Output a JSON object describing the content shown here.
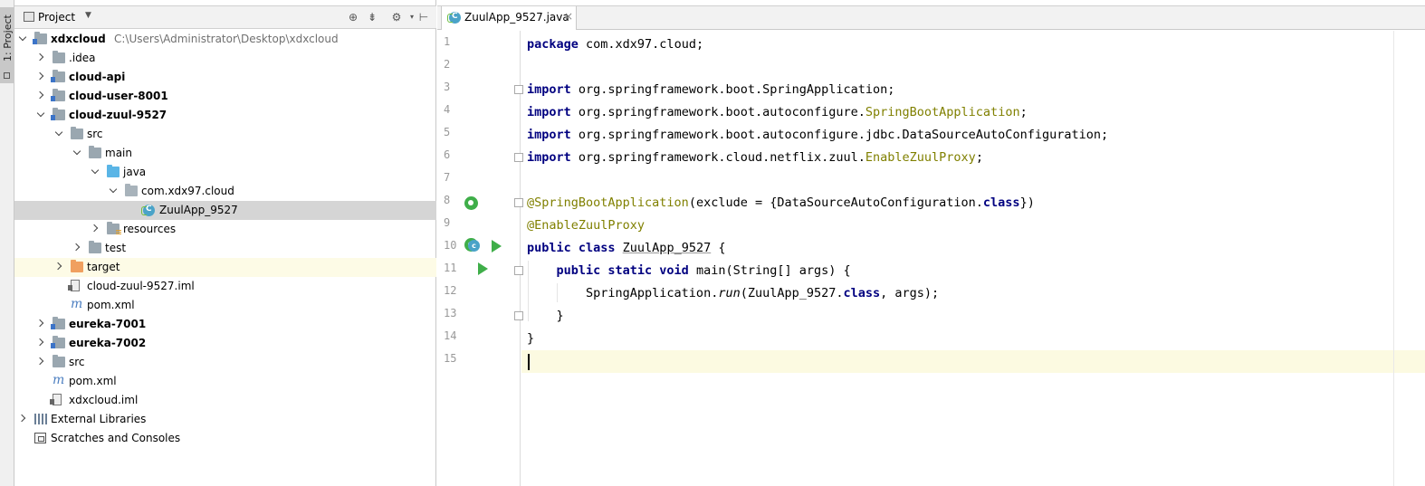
{
  "tool_stripe": {
    "project_tab_label": "1: Project"
  },
  "project_panel": {
    "title": "Project",
    "tree": [
      {
        "label": "xdxcloud",
        "path": "C:\\Users\\Administrator\\Desktop\\xdxcloud",
        "bold": true,
        "expanded": true,
        "icon": "module-folder-icon",
        "depth": 0
      },
      {
        "label": ".idea",
        "expanded": false,
        "icon": "folder-icon",
        "depth": 1
      },
      {
        "label": "cloud-api",
        "bold": true,
        "expanded": false,
        "icon": "module-folder-icon",
        "depth": 1
      },
      {
        "label": "cloud-user-8001",
        "bold": true,
        "expanded": false,
        "icon": "module-folder-icon",
        "depth": 1
      },
      {
        "label": "cloud-zuul-9527",
        "bold": true,
        "expanded": true,
        "icon": "module-folder-icon",
        "depth": 1
      },
      {
        "label": "src",
        "expanded": true,
        "icon": "folder-icon",
        "depth": 2
      },
      {
        "label": "main",
        "expanded": true,
        "icon": "folder-icon",
        "depth": 3
      },
      {
        "label": "java",
        "expanded": true,
        "icon": "source-folder-icon",
        "depth": 4
      },
      {
        "label": "com.xdx97.cloud",
        "expanded": true,
        "icon": "package-icon",
        "depth": 5
      },
      {
        "label": "ZuulApp_9527",
        "icon": "spring-boot-class-icon",
        "depth": 6,
        "selected": true
      },
      {
        "label": "resources",
        "expanded": false,
        "icon": "resources-folder-icon",
        "depth": 4
      },
      {
        "label": "test",
        "expanded": false,
        "icon": "folder-icon",
        "depth": 3
      },
      {
        "label": "target",
        "expanded": false,
        "icon": "excluded-folder-icon",
        "depth": 2,
        "highlight": true
      },
      {
        "label": "cloud-zuul-9527.iml",
        "icon": "iml-file-icon",
        "depth": 2
      },
      {
        "label": "pom.xml",
        "icon": "maven-icon",
        "depth": 2
      },
      {
        "label": "eureka-7001",
        "bold": true,
        "expanded": false,
        "icon": "module-folder-icon",
        "depth": 1
      },
      {
        "label": "eureka-7002",
        "bold": true,
        "expanded": false,
        "icon": "module-folder-icon",
        "depth": 1
      },
      {
        "label": "src",
        "expanded": false,
        "icon": "folder-icon",
        "depth": 1
      },
      {
        "label": "pom.xml",
        "icon": "maven-icon",
        "depth": 1
      },
      {
        "label": "xdxcloud.iml",
        "icon": "iml-file-icon",
        "depth": 1
      },
      {
        "label": "External Libraries",
        "expanded": false,
        "icon": "libraries-icon",
        "depth": 0
      },
      {
        "label": "Scratches and Consoles",
        "icon": "scratches-icon",
        "depth": 0
      }
    ]
  },
  "editor": {
    "tab": {
      "label": "ZuulApp_9527.java",
      "close": "×"
    },
    "lines": [
      [
        {
          "t": "package ",
          "c": "kw"
        },
        {
          "t": "com.xdx97.cloud;"
        }
      ],
      [],
      [
        {
          "t": "import ",
          "c": "kw"
        },
        {
          "t": "org.springframework.boot.SpringApplication;"
        }
      ],
      [
        {
          "t": "import ",
          "c": "kw"
        },
        {
          "t": "org.springframework.boot.autoconfigure."
        },
        {
          "t": "SpringBootApplication",
          "c": "ann"
        },
        {
          "t": ";"
        }
      ],
      [
        {
          "t": "import ",
          "c": "kw"
        },
        {
          "t": "org.springframework.boot.autoconfigure.jdbc.DataSourceAutoConfiguration;"
        }
      ],
      [
        {
          "t": "import ",
          "c": "kw"
        },
        {
          "t": "org.springframework.cloud.netflix.zuul."
        },
        {
          "t": "EnableZuulProxy",
          "c": "ann"
        },
        {
          "t": ";"
        }
      ],
      [],
      [
        {
          "t": "@SpringBootApplication",
          "c": "ann"
        },
        {
          "t": "(exclude = {DataSourceAutoConfiguration."
        },
        {
          "t": "class",
          "c": "kw"
        },
        {
          "t": "})"
        }
      ],
      [
        {
          "t": "@EnableZuulProxy",
          "c": "ann"
        }
      ],
      [
        {
          "t": "public class ",
          "c": "kw"
        },
        {
          "t": "ZuulApp_9527",
          "c": "ul"
        },
        {
          "t": " {"
        }
      ],
      [
        {
          "t": "    "
        },
        {
          "t": "public static void ",
          "c": "kw"
        },
        {
          "t": "main(String[] args) {"
        }
      ],
      [
        {
          "t": "        SpringApplication."
        },
        {
          "t": "run",
          "c": "italic"
        },
        {
          "t": "(ZuulApp_9527."
        },
        {
          "t": "class",
          "c": "kw"
        },
        {
          "t": ", args);"
        }
      ],
      [
        {
          "t": "    }"
        }
      ],
      [
        {
          "t": "}"
        }
      ],
      []
    ],
    "current_line": 15
  }
}
